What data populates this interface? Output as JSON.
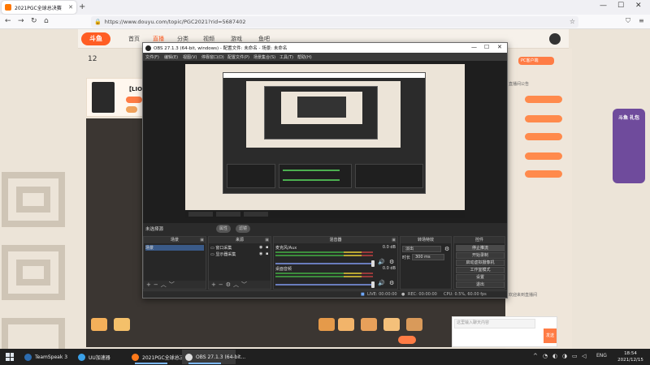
{
  "browser": {
    "tab_title": "2021PGC全球总决赛",
    "url": "https://www.douyu.com/topic/PGC2021?rid=5687402",
    "new_tab": "+",
    "min": "—",
    "max": "☐",
    "close": "✕"
  },
  "site": {
    "logo": "斗鱼",
    "menu": [
      "首页",
      "直播",
      "分类",
      "视频",
      "游戏",
      "鱼吧"
    ],
    "follow_count": "12",
    "streamer_name": "【LION",
    "right_tag": "PC客户端",
    "side_ad": "斗鱼\n礼包",
    "chat_placeholder": "这里输入聊天内容",
    "send": "发送",
    "right_text": [
      "直播间公告",
      "欢迎来到直播间"
    ]
  },
  "obs": {
    "title": "OBS 27.1.3 (64-bit, windows) - 配置文件: 未命名 - 场景: 未命名",
    "menus": [
      "文件(F)",
      "编辑(E)",
      "视图(V)",
      "停靠窗口(D)",
      "配置文件(P)",
      "场景集合(S)",
      "工具(T)",
      "帮助(H)"
    ],
    "no_source": "未选择源",
    "properties": "属性",
    "filters": "滤镜",
    "docks": {
      "scenes": "场景",
      "sources": "来源",
      "mixer": "混音器",
      "transitions": "转场特效",
      "controls": "控件"
    },
    "scenes": [
      "场景"
    ],
    "sources": [
      "窗口采集",
      "显示器采集"
    ],
    "mixer": [
      {
        "name": "麦克风/Aux",
        "db": "0.0 dB"
      },
      {
        "name": "桌面音频",
        "db": "0.0 dB"
      }
    ],
    "transition_value": "淡出",
    "duration_label": "时长",
    "duration_value": "300 ms",
    "controls": [
      "停止推流",
      "开始录制",
      "启动虚拟摄像机",
      "工作室模式",
      "设置",
      "退出"
    ],
    "status": {
      "live": "LIVE: 00:00:00",
      "rec": "REC: 00:00:00",
      "cpu": "CPU: 0.5%, 60.00 fps"
    }
  },
  "taskbar": {
    "apps": [
      "TeamSpeak 3",
      "UU加速器",
      "2021PGC全球总决...",
      "OBS 27.1.3 (64-bit..."
    ],
    "lang": "ENG",
    "time": "18:54",
    "date": "2021/12/15"
  },
  "colors": {
    "brand": "#ff5d23",
    "obs_bg": "#2b2b2b",
    "taskbar": "#202020"
  }
}
